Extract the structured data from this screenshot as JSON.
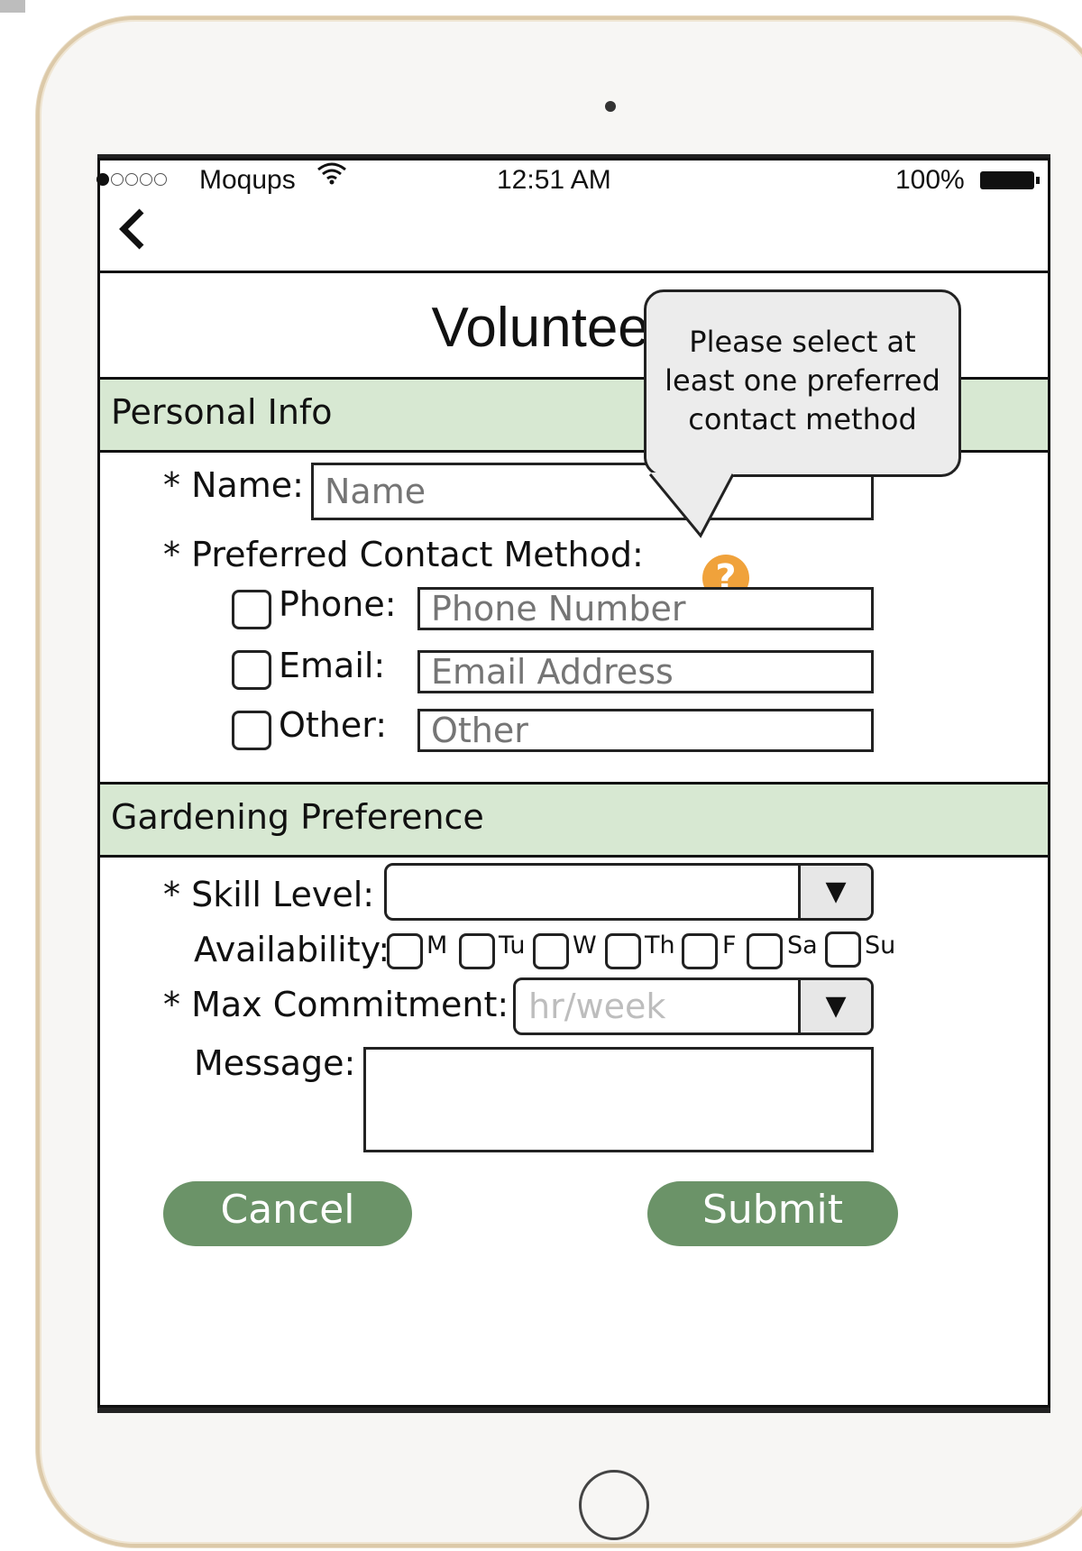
{
  "status_bar": {
    "carrier": "Moqups",
    "wifi_icon": "wifi-icon",
    "time": "12:51 AM",
    "battery": "100%"
  },
  "nav": {
    "back_icon": "‹"
  },
  "title": "Volunteer App",
  "tooltip": {
    "line1": "Please select at",
    "line2": "least one preferred",
    "line3": "contact method"
  },
  "personal_info": {
    "heading": "Personal Info",
    "name_label": "* Name:",
    "name_placeholder": "Name",
    "contact_label": "* Preferred Contact Method:",
    "help_icon": "?",
    "phone_label": "Phone:",
    "phone_placeholder": "Phone Number",
    "email_label": "Email:",
    "email_placeholder": "Email Address",
    "other_label": "Other:",
    "other_placeholder": "Other"
  },
  "gardening": {
    "heading": "Gardening Preference",
    "skill_label": "* Skill Level:",
    "skill_value": "",
    "availability_label": "Availability:",
    "days": [
      "M",
      "Tu",
      "W",
      "Th",
      "F",
      "Sa",
      "Su"
    ],
    "commitment_label": "* Max Commitment:",
    "commitment_placeholder": "hr/week",
    "message_label": "Message:",
    "message_value": ""
  },
  "buttons": {
    "cancel": "Cancel",
    "submit": "Submit"
  },
  "colors": {
    "section_band": "#d7e8d2",
    "button": "#6b9368",
    "help_icon": "#f0a23b",
    "placeholder": "#bdbdbd",
    "frame": "#dcc9a8"
  }
}
